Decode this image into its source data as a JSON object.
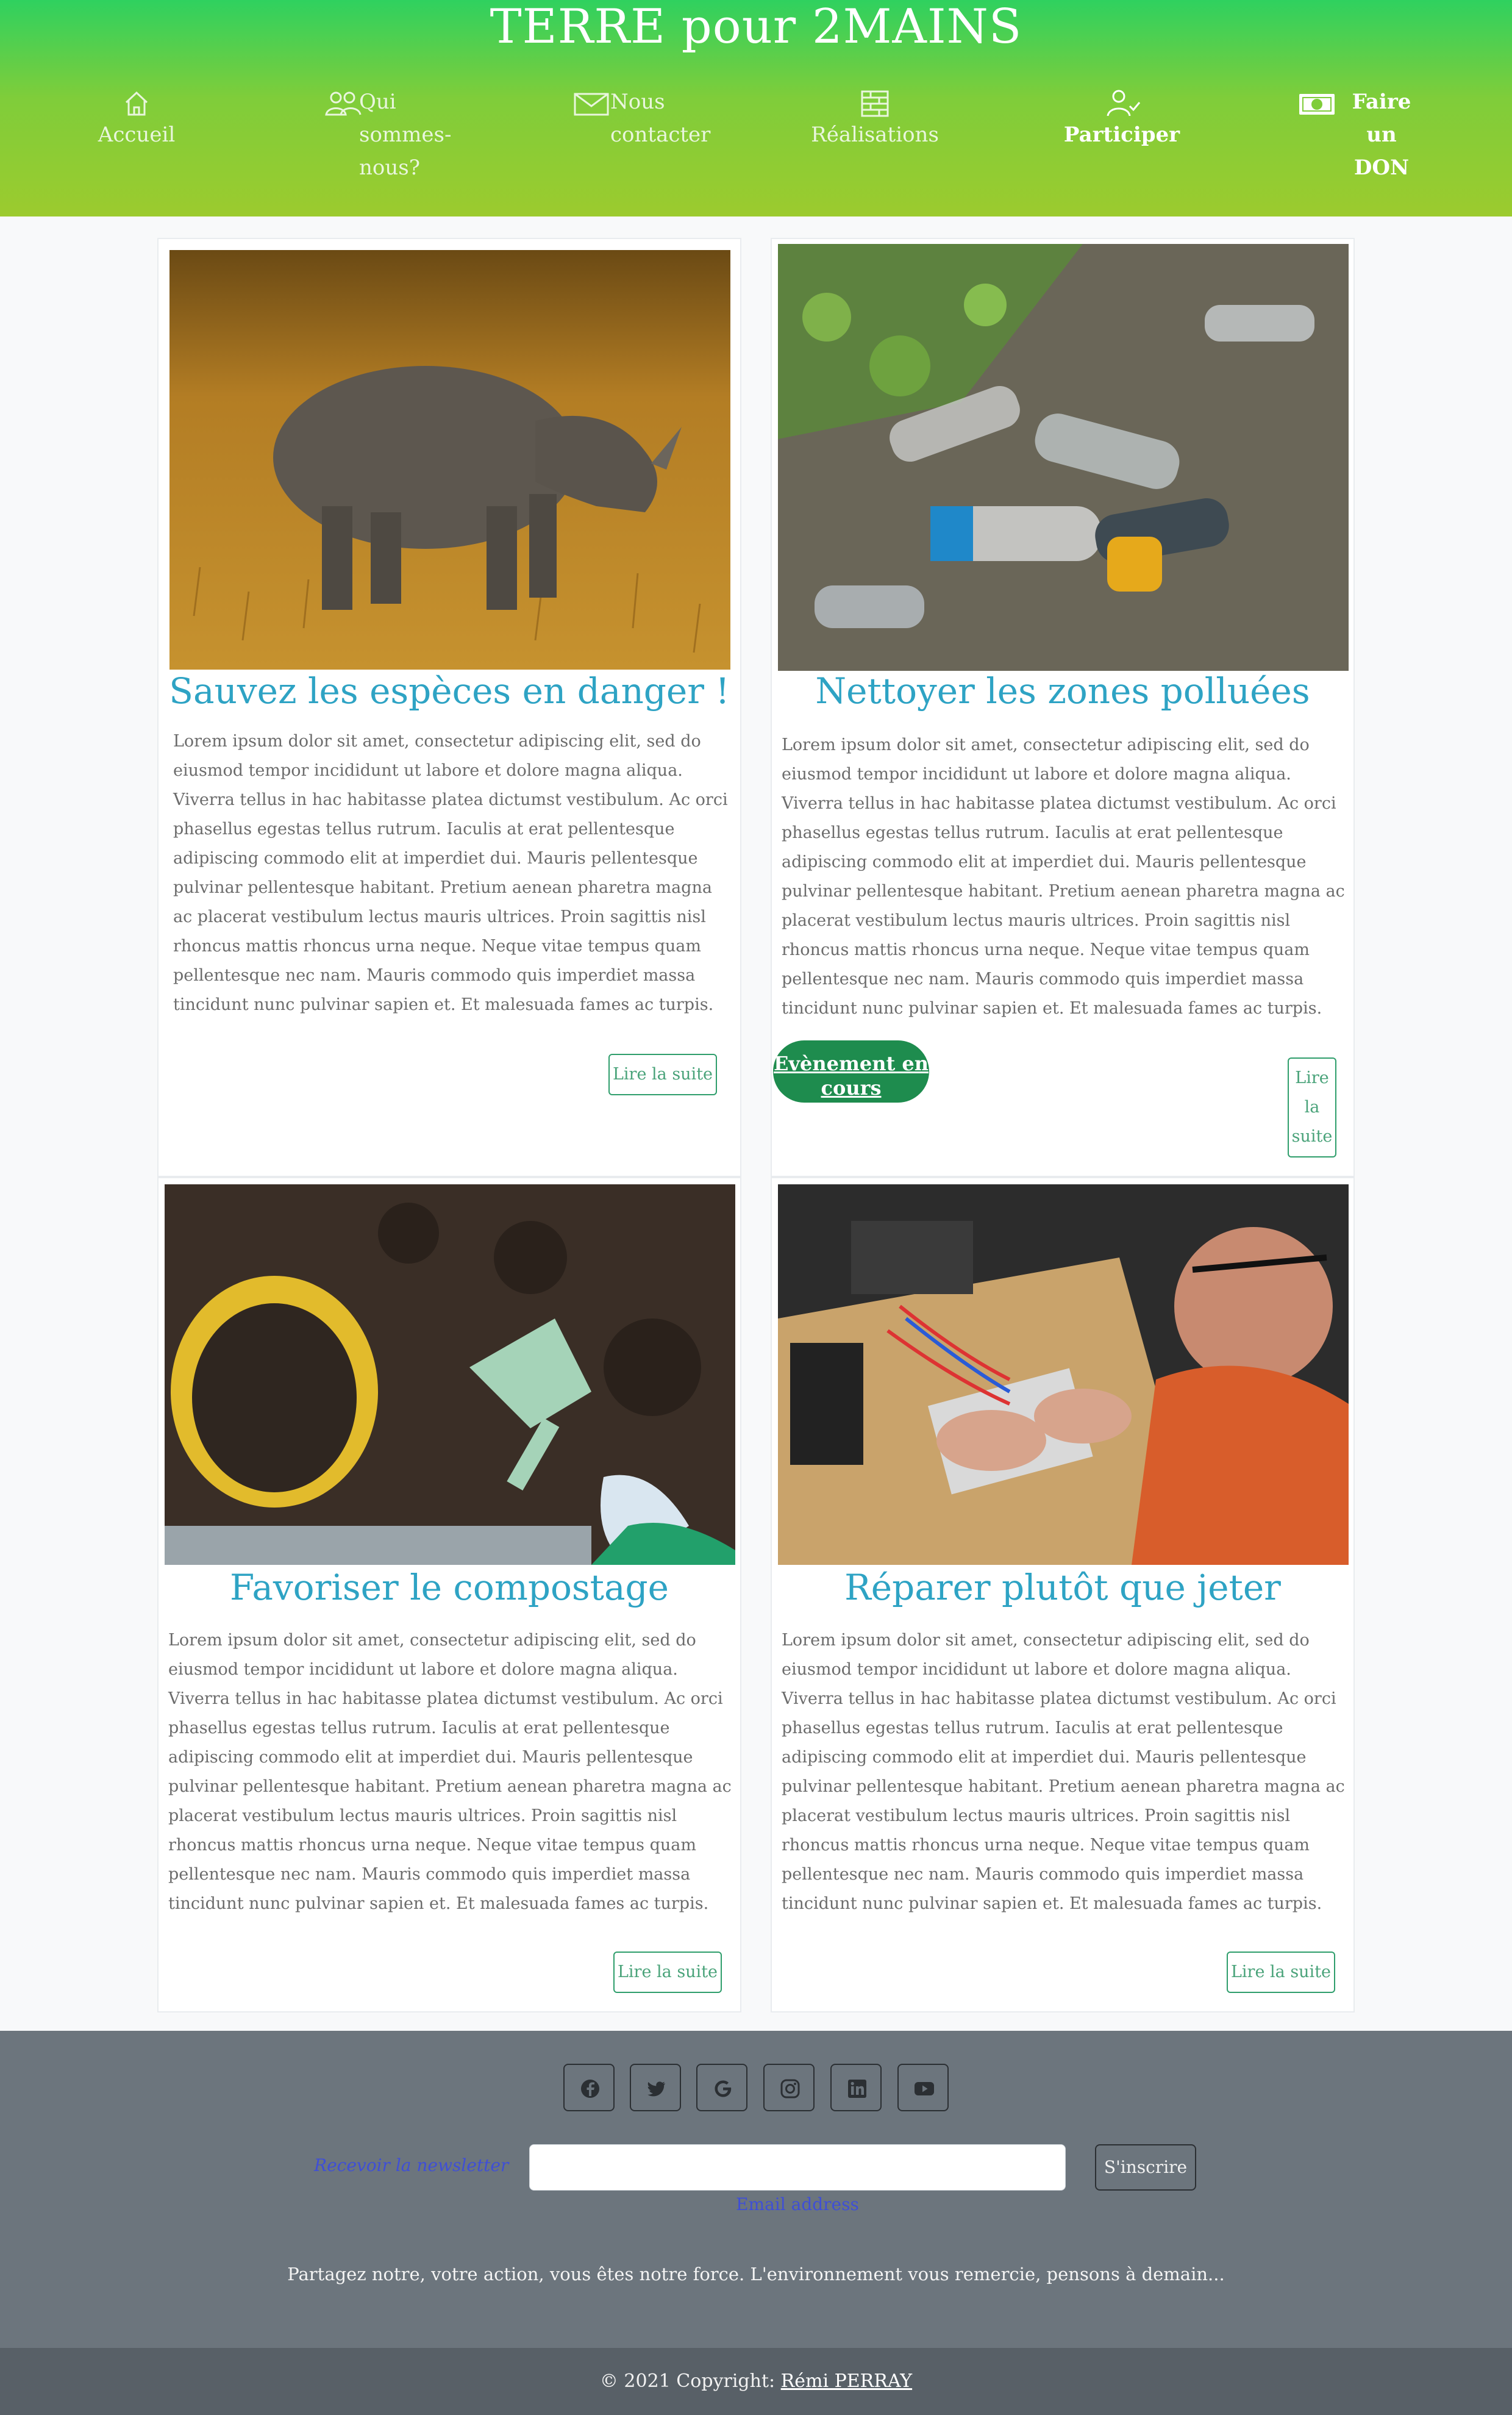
{
  "site": {
    "title": "TERRE pour 2MAINS"
  },
  "nav": [
    {
      "label": "Accueil",
      "icon": "home-icon"
    },
    {
      "label": "Qui sommes-nous?",
      "icon": "users-icon"
    },
    {
      "label": "Nous contacter",
      "icon": "envelope-icon"
    },
    {
      "label": "Réalisations",
      "icon": "bricks-icon"
    },
    {
      "label": "Participer",
      "icon": "person-check-icon"
    },
    {
      "label": "Faire un DON",
      "icon": "cash-icon"
    }
  ],
  "cards": [
    {
      "title": "Sauvez les espèces en danger !",
      "text": "Lorem ipsum dolor sit amet, consectetur adipiscing elit, sed do eiusmod tempor incididunt ut labore et dolore magna aliqua. Viverra tellus in hac habitasse platea dictumst vestibulum. Ac orci phasellus egestas tellus rutrum. Iaculis at erat pellentesque adipiscing commodo elit at imperdiet dui. Mauris pellentesque pulvinar pellentesque habitant. Pretium aenean pharetra magna ac placerat vestibulum lectus mauris ultrices. Proin sagittis nisl rhoncus mattis rhoncus urna neque. Neque vitae tempus quam pellentesque nec nam. Mauris commodo quis imperdiet massa tincidunt nunc pulvinar sapien et. Et malesuada fames ac turpis.",
      "button": "Lire la suite",
      "image": "rhinoceros"
    },
    {
      "title": "Nettoyer les zones polluées",
      "text": "Lorem ipsum dolor sit amet, consectetur adipiscing elit, sed do eiusmod tempor incididunt ut labore et dolore magna aliqua. Viverra tellus in hac habitasse platea dictumst vestibulum. Ac orci phasellus egestas tellus rutrum. Iaculis at erat pellentesque adipiscing commodo elit at imperdiet dui. Mauris pellentesque pulvinar pellentesque habitant. Pretium aenean pharetra magna ac placerat vestibulum lectus mauris ultrices. Proin sagittis nisl rhoncus mattis rhoncus urna neque. Neque vitae tempus quam pellentesque nec nam. Mauris commodo quis imperdiet massa tincidunt nunc pulvinar sapien et. Et malesuada fames ac turpis.",
      "button": "Lire la suite",
      "badge": "Evènement en cours",
      "image": "plastic-bottles"
    },
    {
      "title": "Favoriser le compostage",
      "text": "Lorem ipsum dolor sit amet, consectetur adipiscing elit, sed do eiusmod tempor incididunt ut labore et dolore magna aliqua. Viverra tellus in hac habitasse platea dictumst vestibulum. Ac orci phasellus egestas tellus rutrum. Iaculis at erat pellentesque adipiscing commodo elit at imperdiet dui. Mauris pellentesque pulvinar pellentesque habitant. Pretium aenean pharetra magna ac placerat vestibulum lectus mauris ultrices. Proin sagittis nisl rhoncus mattis rhoncus urna neque. Neque vitae tempus quam pellentesque nec nam. Mauris commodo quis imperdiet massa tincidunt nunc pulvinar sapien et. Et malesuada fames ac turpis.",
      "button": "Lire la suite",
      "image": "compost"
    },
    {
      "title": "Réparer plutôt que jeter",
      "text": "Lorem ipsum dolor sit amet, consectetur adipiscing elit, sed do eiusmod tempor incididunt ut labore et dolore magna aliqua. Viverra tellus in hac habitasse platea dictumst vestibulum. Ac orci phasellus egestas tellus rutrum. Iaculis at erat pellentesque adipiscing commodo elit at imperdiet dui. Mauris pellentesque pulvinar pellentesque habitant. Pretium aenean pharetra magna ac placerat vestibulum lectus mauris ultrices. Proin sagittis nisl rhoncus mattis rhoncus urna neque. Neque vitae tempus quam pellentesque nec nam. Mauris commodo quis imperdiet massa tincidunt nunc pulvinar sapien et. Et malesuada fames ac turpis.",
      "button": "Lire la suite",
      "image": "repair"
    }
  ],
  "footer": {
    "social": [
      "facebook-icon",
      "twitter-icon",
      "google-icon",
      "instagram-icon",
      "linkedin-icon",
      "youtube-icon"
    ],
    "newsletter_label": "Recevoir la newsletter",
    "email_placeholder": "",
    "email_help": "Email address",
    "subscribe": "S'inscrire",
    "tagline": "Partagez notre, votre action, vous êtes notre force. L'environnement vous remercie, pensons à demain...",
    "copyright_prefix": "© 2021 Copyright:",
    "copyright_author": "Rémi PERRAY"
  },
  "colors": {
    "header_top": "#2fd15f",
    "header_bottom": "#9ccb2e",
    "title": "#2ea3c4",
    "badge": "#1e8c4e",
    "footer": "#6c757d"
  }
}
